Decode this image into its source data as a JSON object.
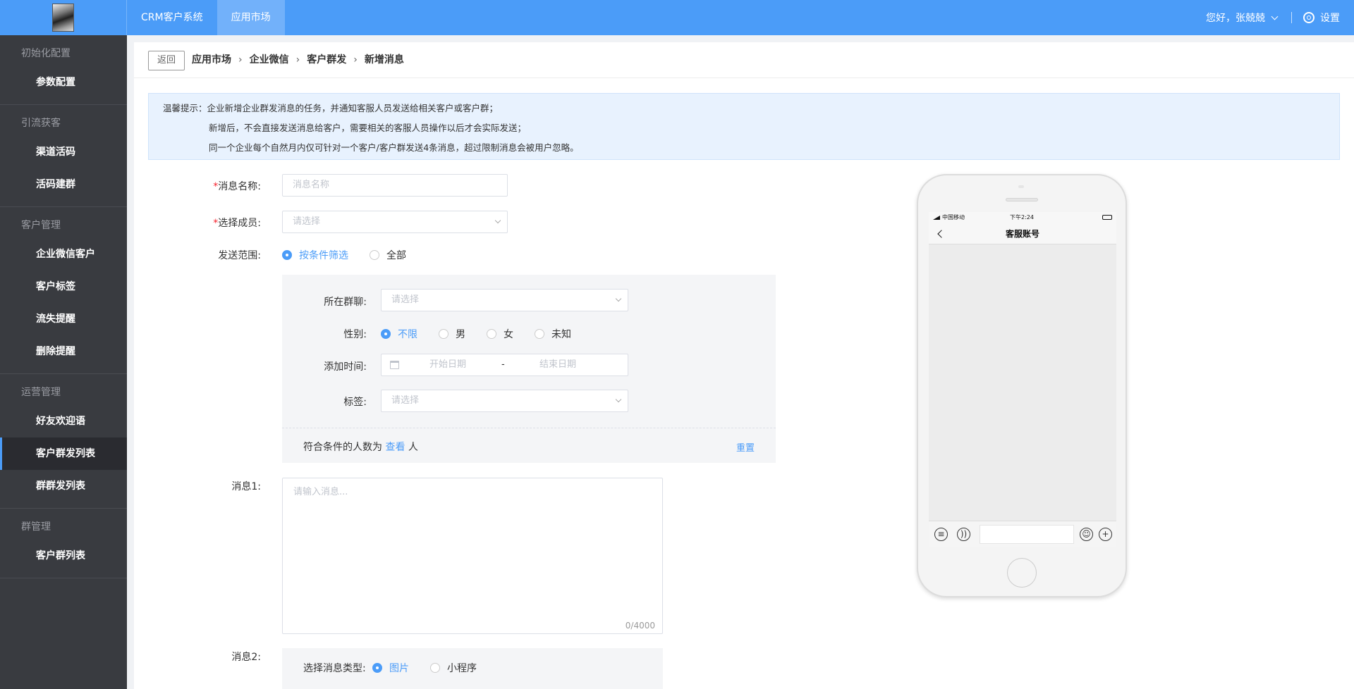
{
  "header": {
    "nav": [
      "CRM客户系统",
      "应用市场"
    ],
    "active_nav": 1,
    "greeting": "您好，张兢兢",
    "settings": "设置"
  },
  "sidebar": {
    "groups": [
      {
        "title": "初始化配置",
        "items": [
          "参数配置"
        ]
      },
      {
        "title": "引流获客",
        "items": [
          "渠道活码",
          "活码建群"
        ]
      },
      {
        "title": "客户管理",
        "items": [
          "企业微信客户",
          "客户标签",
          "流失提醒",
          "删除提醒"
        ]
      },
      {
        "title": "运营管理",
        "items": [
          "好友欢迎语",
          "客户群发列表",
          "群群发列表"
        ]
      },
      {
        "title": "群管理",
        "items": [
          "客户群列表"
        ]
      }
    ],
    "active": "客户群发列表"
  },
  "breadcrumb": {
    "back": "返回",
    "items": [
      "应用市场",
      "企业微信",
      "客户群发",
      "新增消息"
    ]
  },
  "notice": {
    "line1": "温馨提示：企业新增企业群发消息的任务，并通知客服人员发送给相关客户或客户群；",
    "line2": "新增后，不会直接发送消息给客户，需要相关的客服人员操作以后才会实际发送；",
    "line3": "同一个企业每个自然月内仅可针对一个客户/客户群发送4条消息，超过限制消息会被用户忽略。"
  },
  "form": {
    "name_label": "消息名称:",
    "name_placeholder": "消息名称",
    "member_label": "选择成员:",
    "member_placeholder": "请选择",
    "scope_label": "发送范围:",
    "scope_options": [
      "按条件筛选",
      "全部"
    ],
    "scope_selected": "按条件筛选",
    "filter": {
      "group_label": "所在群聊:",
      "group_placeholder": "请选择",
      "gender_label": "性别:",
      "gender_options": [
        "不限",
        "男",
        "女",
        "未知"
      ],
      "gender_selected": "不限",
      "time_label": "添加时间:",
      "start_placeholder": "开始日期",
      "range_sep": "-",
      "end_placeholder": "结束日期",
      "tag_label": "标签:",
      "tag_placeholder": "请选择",
      "count_prefix": "符合条件的人数为",
      "count_link": "查看",
      "count_suffix": "人",
      "reset": "重置"
    },
    "msg1_label": "消息1:",
    "msg1_placeholder": "请输入消息...",
    "msg1_count": "0/4000",
    "msg2_label": "消息2:",
    "msg2_type_label": "选择消息类型:",
    "msg2_types": [
      "图片",
      "小程序"
    ],
    "msg2_selected": "图片"
  },
  "phone": {
    "carrier": "中国移动",
    "time": "下午2:24",
    "title": "客服账号"
  },
  "colors": {
    "accent": "#4b9cf8",
    "sidebar_bg": "#393b40",
    "notice_bg": "#e8f2fe"
  }
}
